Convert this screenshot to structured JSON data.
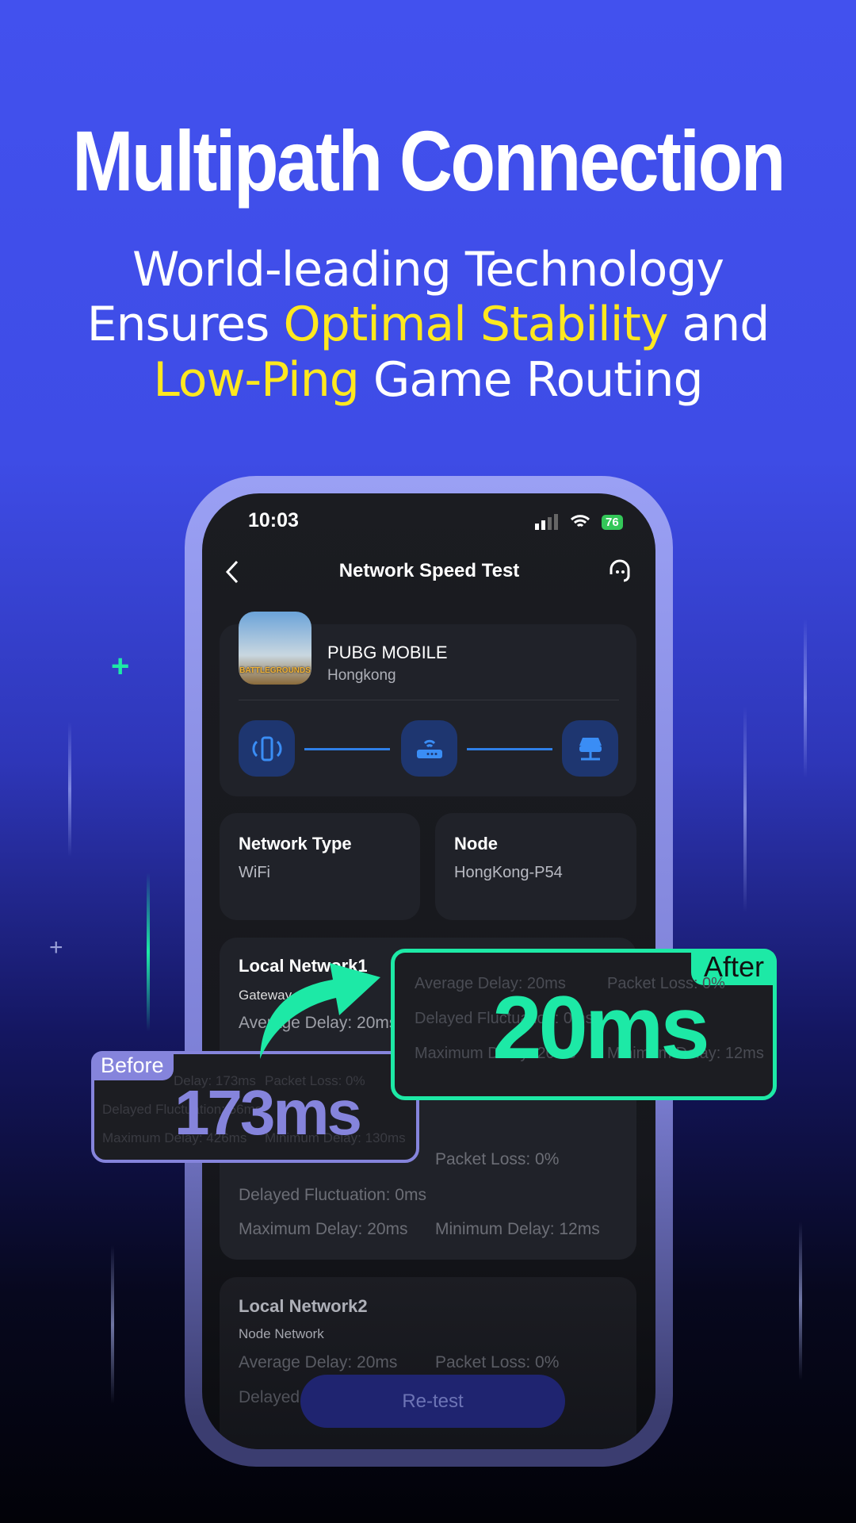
{
  "headline": "Multipath Connection",
  "subtitle": {
    "line1": "World-leading Technology",
    "line2_a": "Ensures ",
    "line2_hl": "Optimal Stability",
    "line2_b": " and",
    "line3_hl": "Low-Ping",
    "line3_b": " Game Routing"
  },
  "colors": {
    "accent_yellow": "#ffe81f",
    "after_green": "#1de9a6",
    "before_purple": "#8584dc",
    "bg_blue": "#4251ee"
  },
  "status": {
    "time": "10:03",
    "battery": "76"
  },
  "header": {
    "title": "Network Speed Test",
    "back_icon": "chevron-left-icon",
    "support_icon": "headset-icon"
  },
  "game": {
    "name": "PUBG MOBILE",
    "region": "Hongkong",
    "icon_text": "BATTLEGROUNDS"
  },
  "path_icons": [
    "phone-signal-icon",
    "router-icon",
    "server-icon"
  ],
  "info": [
    {
      "label": "Network Type",
      "value": "WiFi"
    },
    {
      "label": "Node",
      "value": "HongKong-P54"
    }
  ],
  "local1": {
    "title": "Local Network1",
    "sub": "Gateway",
    "avg": "Average Delay: 20ms",
    "loss": "Packet Loss: 0%",
    "fluct": "Delayed Fluctuation: 0ms",
    "max": "Maximum Delay: 20ms",
    "min": "Minimum Delay: 12ms"
  },
  "local2": {
    "title": "Local Network2",
    "sub": "Node Network",
    "avg": "Average Delay: 20ms",
    "loss": "Packet Loss: 0%",
    "fluct": "Delayed"
  },
  "retest": "Re-test",
  "before": {
    "tag": "Before",
    "big": "173ms",
    "avg": "Delay: 173ms",
    "loss": "Packet Loss: 0%",
    "fluct": "Delayed Fluctuation: 56ms",
    "max": "Maximum Delay: 426ms",
    "min": "Minimum Delay: 130ms"
  },
  "after": {
    "tag": "After",
    "big": "20ms",
    "avg": "Average Delay: 20ms",
    "loss": "Packet Loss: 0%",
    "fluct": "Delayed Fluctuation: 0ms",
    "max": "Maximum Delay: 20ms",
    "min": "Minimum Delay: 12ms"
  }
}
